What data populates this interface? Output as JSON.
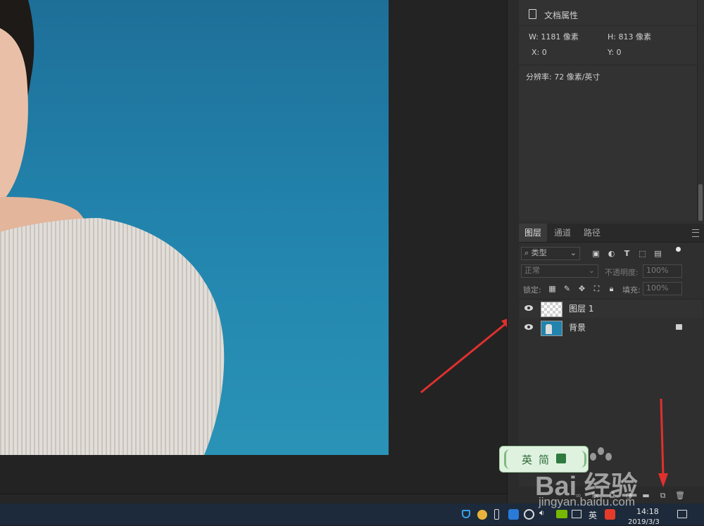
{
  "properties": {
    "title": "文档属性",
    "width": "W:  1181 像素",
    "height": "H:  813 像素",
    "x": "X:  0",
    "y": "Y:  0",
    "resolution": "分辨率: 72 像素/英寸"
  },
  "layers_panel": {
    "tabs": [
      "图层",
      "通道",
      "路径"
    ],
    "filter_kind": "类型",
    "blend_mode": "正常",
    "opacity_label": "不透明度:",
    "opacity_value": "100%",
    "lock_label": "锁定:",
    "fill_label": "填充:",
    "fill_value": "100%",
    "layers": [
      {
        "name": "图层 1",
        "locked": false
      },
      {
        "name": "背景",
        "locked": true
      }
    ]
  },
  "ime": {
    "lang": "英",
    "mode": "简"
  },
  "taskbar": {
    "time": "14:18",
    "date": "2019/3/3",
    "lang": "英"
  },
  "watermark": {
    "brand": "Bai  经验",
    "url": "jingyan.baidu.com"
  },
  "colors": {
    "canvas_bg": "#2284ad",
    "panel_bg": "#2f2f2f",
    "arrow": "#e0302e"
  }
}
